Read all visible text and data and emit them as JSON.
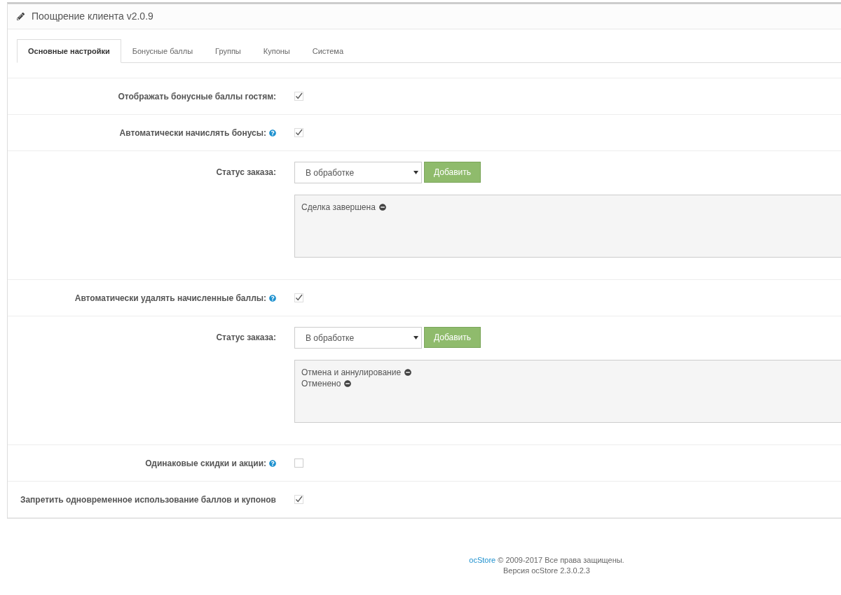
{
  "panel": {
    "title": "Поощрение клиента v2.0.9"
  },
  "tabs": [
    {
      "label": "Основные настройки",
      "selected": true
    },
    {
      "label": "Бонусные баллы",
      "selected": false
    },
    {
      "label": "Группы",
      "selected": false
    },
    {
      "label": "Купоны",
      "selected": false
    },
    {
      "label": "Система",
      "selected": false
    }
  ],
  "rows": [
    {
      "kind": "checkbox",
      "label": "Отображать бонусные баллы гостям:",
      "help": false,
      "checked": true
    },
    {
      "kind": "checkbox",
      "label": "Автоматически начислять бонусы:",
      "help": true,
      "checked": true
    },
    {
      "kind": "status",
      "label": "Статус заказа:",
      "select": "В обработке",
      "button": "Добавить",
      "items": [
        "Сделка завершена"
      ]
    },
    {
      "kind": "checkbox",
      "label": "Автоматически удалять начисленные баллы:",
      "help": true,
      "checked": true
    },
    {
      "kind": "status",
      "label": "Статус заказа:",
      "select": "В обработке",
      "button": "Добавить",
      "items": [
        "Отмена и аннулирование",
        "Отменено"
      ]
    },
    {
      "kind": "checkbox",
      "label": "Одинаковые скидки и акции:",
      "help": true,
      "checked": false
    },
    {
      "kind": "checkbox",
      "label": "Запретить одновременное использование баллов и купонов",
      "help": false,
      "checked": true
    }
  ],
  "footer": {
    "link": "ocStore",
    "copyright": "© 2009-2017 Все права защищены.",
    "version": "Версия ocStore 2.3.0.2.3"
  }
}
